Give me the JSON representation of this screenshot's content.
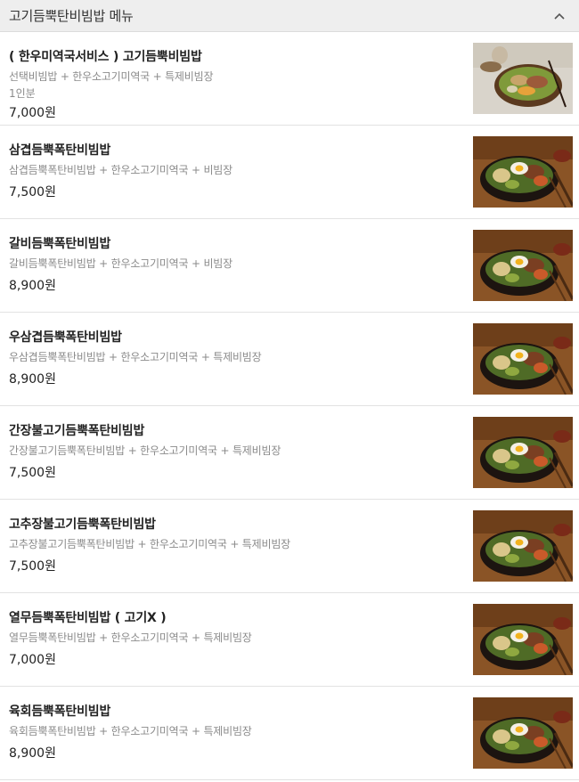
{
  "header": {
    "title": "고기듬뿍탄비빔밥 메뉴"
  },
  "items": [
    {
      "name": "( 한우미역국서비스 ) 고기듬뿍비빔밥",
      "desc": "선택비빔밥 + 한우소고기미역국 + 특제비빔장",
      "serving": "1인분",
      "price": "7,000원",
      "photo": "light"
    },
    {
      "name": "삼겹듬뿍폭탄비빔밥",
      "desc": "삼겹듬뿍폭탄비빔밥 + 한우소고기미역국 + 비빔장",
      "price": "7,500원",
      "photo": "dark"
    },
    {
      "name": "갈비듬뿍폭탄비빔밥",
      "desc": "갈비듬뿍폭탄비빔밥 + 한우소고기미역국 + 비빔장",
      "price": "8,900원",
      "photo": "dark"
    },
    {
      "name": "우삼겹듬뿍폭탄비빔밥",
      "desc": "우삼겹듬뿍폭탄비빔밥 + 한우소고기미역국 + 특제비빔장",
      "price": "8,900원",
      "photo": "dark"
    },
    {
      "name": "간장불고기듬뿍폭탄비빔밥",
      "desc": "간장불고기듬뿍폭탄비빔밥 + 한우소고기미역국 + 특제비빔장",
      "price": "7,500원",
      "photo": "dark"
    },
    {
      "name": "고추장불고기듬뿍폭탄비빔밥",
      "desc": "고추장불고기듬뿍폭탄비빔밥 + 한우소고기미역국 + 특제비빔장",
      "price": "7,500원",
      "photo": "dark"
    },
    {
      "name": "열무듬뿍폭탄비빔밥 ( 고기X )",
      "desc": "열무듬뿍폭탄비빔밥 + 한우소고기미역국 + 특제비빔장",
      "price": "7,000원",
      "photo": "dark"
    },
    {
      "name": "육회듬뿍폭탄비빔밥",
      "desc": "육회듬뿍폭탄비빔밥 + 한우소고기미역국 + 특제비빔장",
      "price": "8,900원",
      "photo": "dark"
    }
  ]
}
